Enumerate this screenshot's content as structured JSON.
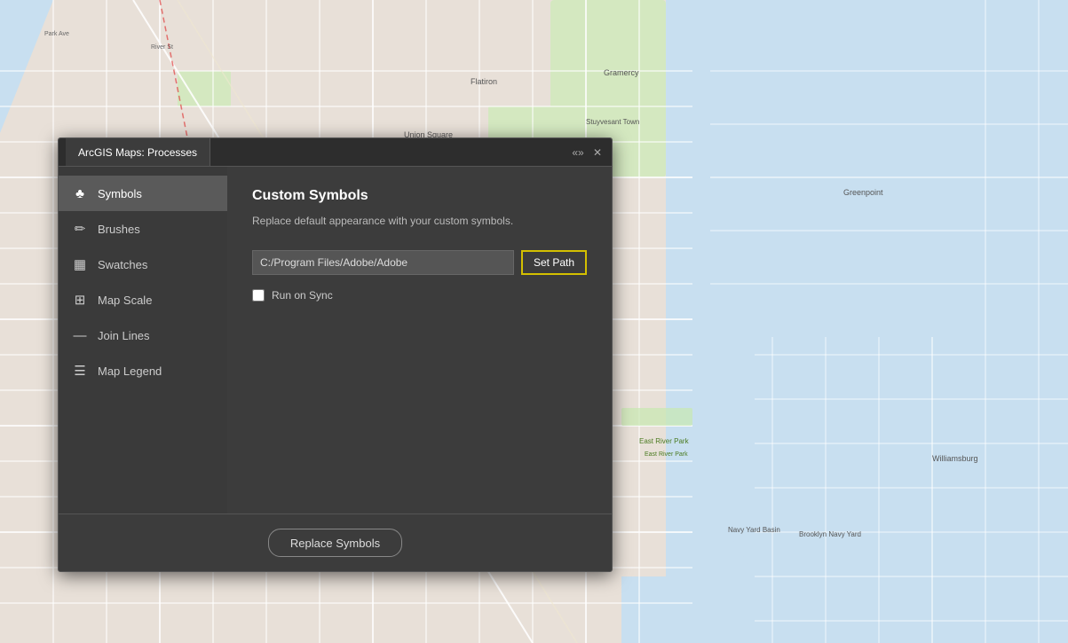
{
  "window": {
    "title": "ArcGIS Maps: Processes",
    "minimize_label": "−",
    "restore_label": "❐",
    "close_label": "✕",
    "double_arrow_label": "«»"
  },
  "sidebar": {
    "items": [
      {
        "id": "symbols",
        "label": "Symbols",
        "icon": "♣",
        "active": true
      },
      {
        "id": "brushes",
        "label": "Brushes",
        "icon": "✏",
        "active": false
      },
      {
        "id": "swatches",
        "label": "Swatches",
        "icon": "▦",
        "active": false
      },
      {
        "id": "map-scale",
        "label": "Map Scale",
        "icon": "⊞",
        "active": false
      },
      {
        "id": "join-lines",
        "label": "Join Lines",
        "icon": "—",
        "active": false
      },
      {
        "id": "map-legend",
        "label": "Map Legend",
        "icon": "☰",
        "active": false
      }
    ]
  },
  "main": {
    "title": "Custom Symbols",
    "description": "Replace default appearance with your custom symbols.",
    "path_value": "C:/Program Files/Adobe/Adobe",
    "path_placeholder": "C:/Program Files/Adobe/Adobe",
    "set_path_label": "Set Path",
    "run_on_sync_label": "Run on Sync",
    "run_on_sync_checked": false,
    "replace_symbols_label": "Replace Symbols"
  }
}
